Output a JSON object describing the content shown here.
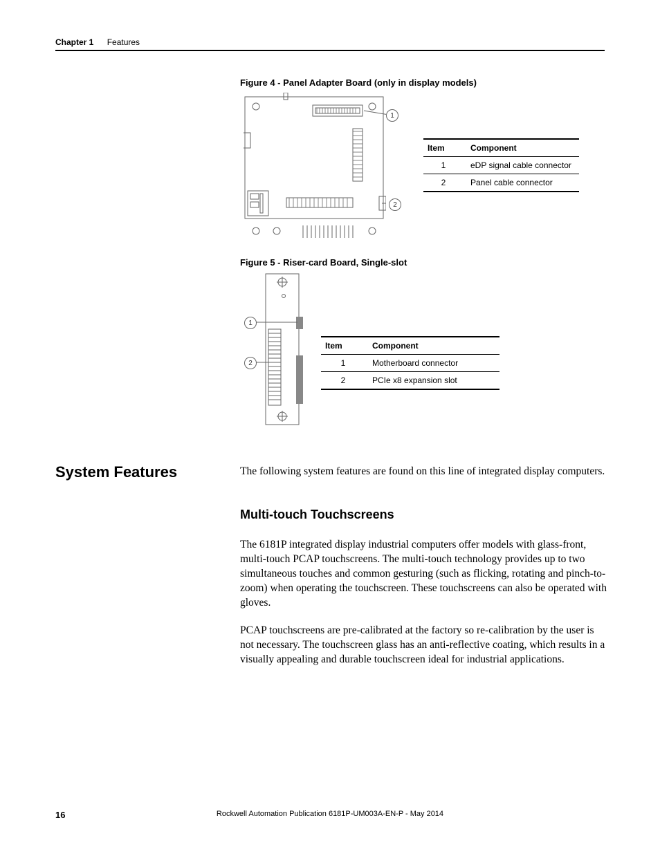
{
  "header": {
    "chapter_label": "Chapter 1",
    "section_label": "Features"
  },
  "figure4": {
    "caption": "Figure 4 - Panel Adapter Board (only in display models)",
    "callouts": {
      "c1": "1",
      "c2": "2"
    },
    "table": {
      "headers": {
        "item": "Item",
        "component": "Component"
      },
      "rows": [
        {
          "item": "1",
          "component": "eDP signal cable connector"
        },
        {
          "item": "2",
          "component": "Panel cable connector"
        }
      ]
    }
  },
  "figure5": {
    "caption": "Figure 5 - Riser-card Board, Single-slot",
    "callouts": {
      "c1": "1",
      "c2": "2"
    },
    "table": {
      "headers": {
        "item": "Item",
        "component": "Component"
      },
      "rows": [
        {
          "item": "1",
          "component": "Motherboard connector"
        },
        {
          "item": "2",
          "component": "PCIe x8 expansion slot"
        }
      ]
    }
  },
  "system_features": {
    "heading": "System Features",
    "intro": "The following system features are found on this line of integrated display computers.",
    "multi_touch": {
      "heading": "Multi-touch Touchscreens",
      "para1": "The 6181P integrated display industrial computers offer models with glass-front, multi-touch PCAP touchscreens. The multi-touch technology provides up to two simultaneous touches and common gesturing (such as flicking, rotating and pinch-to-zoom) when operating the touchscreen. These touchscreens can also be operated with gloves.",
      "para2": "PCAP touchscreens are pre-calibrated at the factory so re-calibration by the user is not necessary. The touchscreen glass has an anti-reflective coating, which results in a visually appealing and durable touchscreen ideal for industrial applications."
    }
  },
  "footer": {
    "publication": "Rockwell Automation Publication 6181P-UM003A-EN-P - May 2014",
    "page_number": "16"
  }
}
